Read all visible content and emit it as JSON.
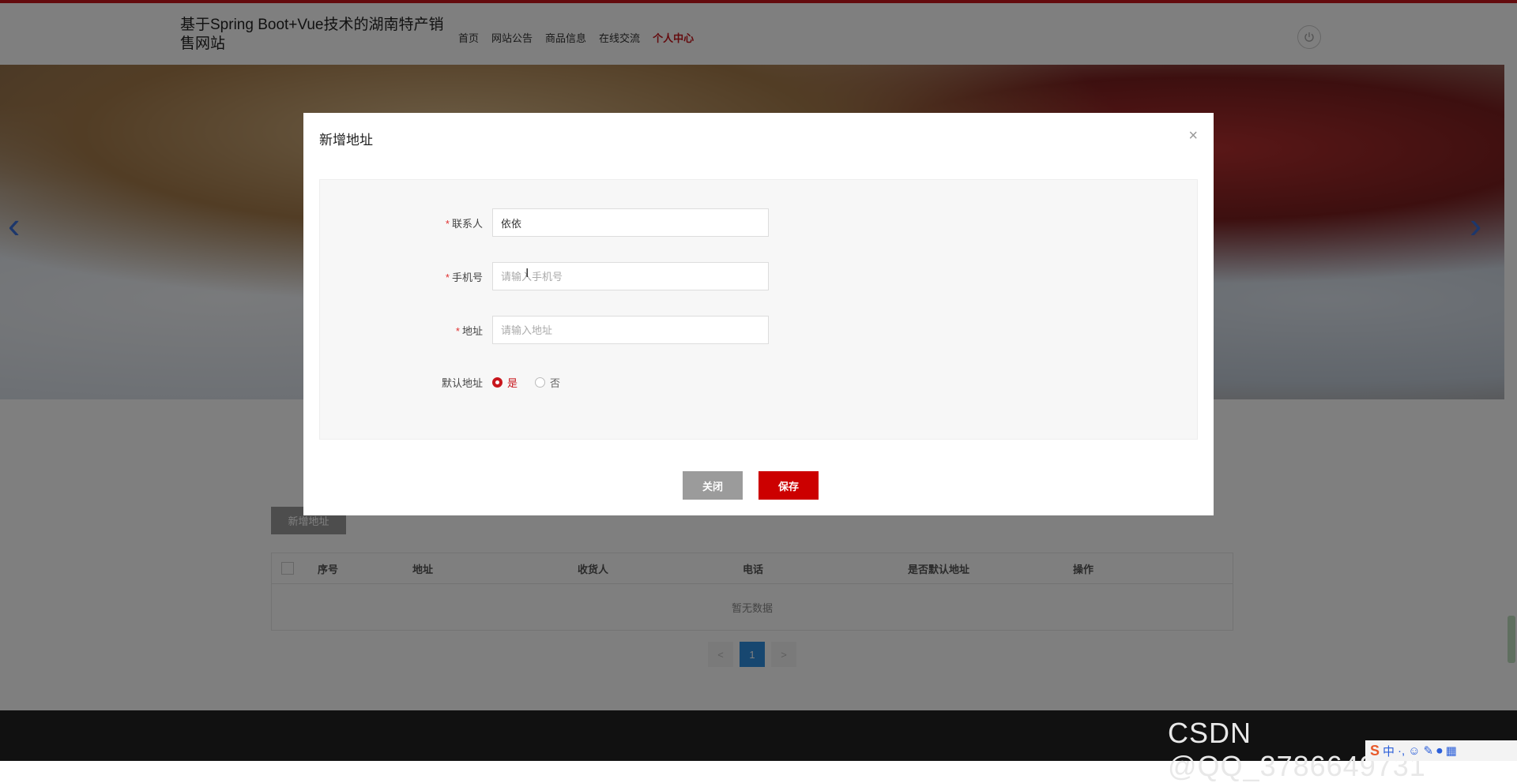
{
  "header": {
    "site_title": "基于Spring Boot+Vue技术的湖南特产销售网站",
    "nav": [
      {
        "label": "首页"
      },
      {
        "label": "网站公告"
      },
      {
        "label": "商品信息"
      },
      {
        "label": "在线交流"
      },
      {
        "label": "个人中心",
        "active": true
      }
    ],
    "power_icon": "power-icon"
  },
  "banner": {
    "prev_glyph": "‹",
    "next_glyph": "›"
  },
  "address_page": {
    "add_button": "新增地址",
    "columns": [
      "序号",
      "地址",
      "收货人",
      "电话",
      "是否默认地址",
      "操作"
    ],
    "empty_text": "暂无数据",
    "pagination": {
      "prev": "<",
      "current": "1",
      "next": ">"
    }
  },
  "modal": {
    "title": "新增地址",
    "close_glyph": "×",
    "contact_label": "联系人",
    "contact_value": "依依",
    "phone_label": "手机号",
    "phone_placeholder": "请输入手机号",
    "address_label": "地址",
    "address_placeholder": "请输入地址",
    "default_label": "默认地址",
    "default_options": [
      {
        "label": "是",
        "selected": true
      },
      {
        "label": "否",
        "selected": false
      }
    ],
    "required_mark": "*",
    "close_button": "关闭",
    "save_button": "保存"
  },
  "footer": {
    "watermark": "CSDN @QQ_3786649731"
  },
  "ime": {
    "logo": "S",
    "mode": "中"
  },
  "colors": {
    "accent": "#c8161d",
    "save": "#cc0000",
    "pager_active": "#2f8fe0"
  }
}
